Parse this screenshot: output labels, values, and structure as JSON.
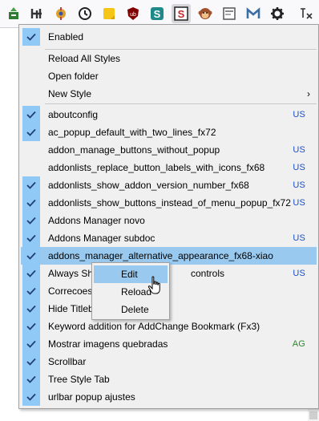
{
  "toolbar": {
    "icons": [
      {
        "name": "extension-save-icon"
      },
      {
        "name": "h-tool-icon"
      },
      {
        "name": "puzzle-gear-icon"
      },
      {
        "name": "clock-icon"
      },
      {
        "name": "sticky-note-icon"
      },
      {
        "name": "ublock-icon",
        "text": "ub"
      },
      {
        "name": "stylish-s-icon",
        "text": "S"
      },
      {
        "name": "stylus-s-icon",
        "text": "S"
      },
      {
        "name": "monkey-icon"
      },
      {
        "name": "page-icon"
      },
      {
        "name": "gmail-m-icon",
        "text": "M"
      },
      {
        "name": "gear-icon"
      },
      {
        "name": "sort-icon"
      }
    ]
  },
  "menu": {
    "enabled_label": "Enabled",
    "reload_all_label": "Reload All Styles",
    "open_folder_label": "Open folder",
    "new_style_label": "New Style",
    "new_style_arrow": "›",
    "styles": [
      {
        "label": "aboutconfig",
        "checked": true,
        "suffix": "US"
      },
      {
        "label": "ac_popup_default_with_two_lines_fx72",
        "checked": true,
        "suffix": ""
      },
      {
        "label": "addon_manage_buttons_without_popup",
        "checked": false,
        "suffix": "US"
      },
      {
        "label": "addonlists_replace_button_labels_with_icons_fx68",
        "checked": false,
        "suffix": "US"
      },
      {
        "label": "addonlists_show_addon_version_number_fx68",
        "checked": true,
        "suffix": "US"
      },
      {
        "label": "addonlists_show_buttons_instead_of_menu_popup_fx72",
        "checked": true,
        "suffix": "US"
      },
      {
        "label": "Addons Manager novo",
        "checked": true,
        "suffix": ""
      },
      {
        "label": "Addons Manager subdoc",
        "checked": true,
        "suffix": "US"
      },
      {
        "label": "addons_manager_alternative_appearance_fx68-xiao",
        "checked": true,
        "suffix": ""
      },
      {
        "label": "Always Sho",
        "label_tail": "controls",
        "checked": true,
        "suffix": "US"
      },
      {
        "label": "Correcoes",
        "checked": true,
        "suffix": ""
      },
      {
        "label": "Hide Titleb",
        "checked": true,
        "suffix": ""
      },
      {
        "label": "Keyword addition for AddChange Bookmark (Fx3)",
        "checked": true,
        "suffix": ""
      },
      {
        "label": "Mostrar imagens quebradas",
        "checked": true,
        "suffix": "AG"
      },
      {
        "label": "Scrollbar",
        "checked": true,
        "suffix": ""
      },
      {
        "label": "Tree Style Tab",
        "checked": true,
        "suffix": ""
      },
      {
        "label": "urlbar popup ajustes",
        "checked": true,
        "suffix": ""
      }
    ]
  },
  "submenu": {
    "edit_label": "Edit",
    "reload_label": "Reload",
    "delete_label": "Delete"
  },
  "colors": {
    "suffix_us": "#1a4fc8",
    "suffix_ag": "#2a8a2a",
    "hover": "#99c9ef",
    "check_bg": "#90c8f6"
  }
}
